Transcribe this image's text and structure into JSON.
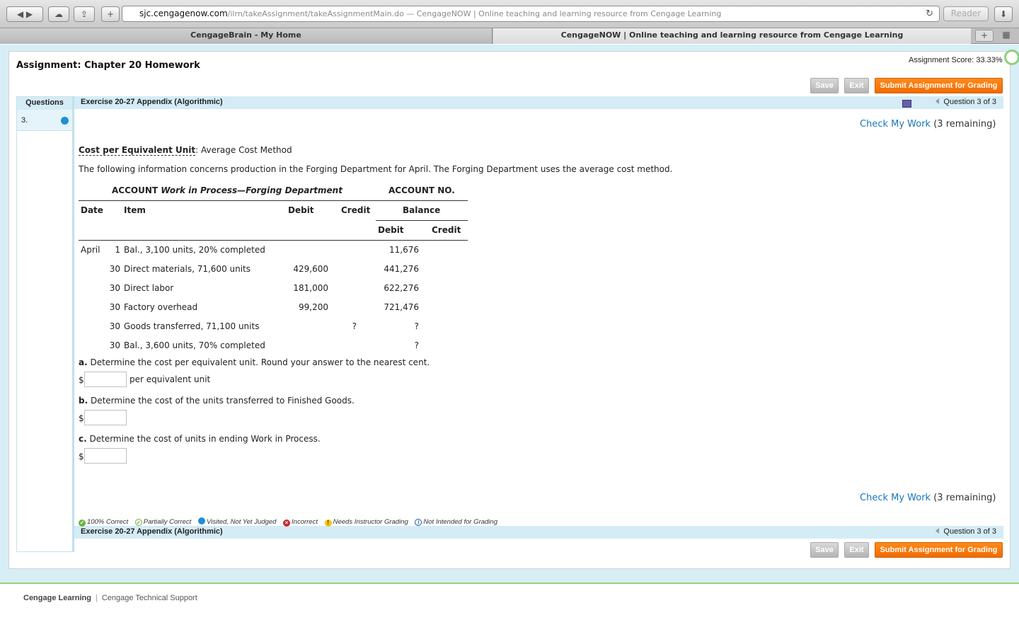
{
  "browser": {
    "url_domain": "sjc.cengagenow.com",
    "url_path": "/ilrn/takeAssignment/takeAssignmentMain.do",
    "url_title": " — CengageNOW | Online teaching and learning resource from Cengage Learning",
    "reader_label": "Reader",
    "tabs": [
      {
        "label": "CengageBrain - My Home"
      },
      {
        "label": "CengageNOW | Online teaching and learning resource from Cengage Learning"
      }
    ]
  },
  "assignment": {
    "title": "Assignment: Chapter 20 Homework",
    "score": "Assignment Score: 33.33%"
  },
  "buttons": {
    "save": "Save",
    "exit": "Exit",
    "submit": "Submit Assignment for Grading"
  },
  "sidebar": {
    "header": "Questions",
    "items": [
      {
        "label": "3.",
        "status": "visited"
      }
    ]
  },
  "exercise": {
    "title": "Exercise 20-27 Appendix (Algorithmic)",
    "question_nav": "Question 3 of 3",
    "check_link": "Check My Work",
    "check_remaining": "(3 remaining)"
  },
  "problem": {
    "topic": "Cost per Equivalent Unit",
    "topic_rest": ": Average Cost Method",
    "description": "The following information concerns production in the Forging Department for April. The Forging Department uses the average cost method.",
    "account_prefix": "ACCOUNT",
    "account_name": "Work in Process—Forging Department",
    "account_no": "ACCOUNT NO.",
    "headers": {
      "date": "Date",
      "item": "Item",
      "debit": "Debit",
      "credit": "Credit",
      "balance": "Balance",
      "bal_debit": "Debit",
      "bal_credit": "Credit"
    },
    "rows": [
      {
        "month": "April",
        "day": "1",
        "item": "Bal., 3,100 units, 20% completed",
        "debit": "",
        "credit": "",
        "bal_debit": "11,676"
      },
      {
        "month": "",
        "day": "30",
        "item": "Direct materials, 71,600 units",
        "debit": "429,600",
        "credit": "",
        "bal_debit": "441,276"
      },
      {
        "month": "",
        "day": "30",
        "item": "Direct labor",
        "debit": "181,000",
        "credit": "",
        "bal_debit": "622,276"
      },
      {
        "month": "",
        "day": "30",
        "item": "Factory overhead",
        "debit": "99,200",
        "credit": "",
        "bal_debit": "721,476"
      },
      {
        "month": "",
        "day": "30",
        "item": "Goods transferred, 71,100 units",
        "debit": "",
        "credit": "?",
        "bal_debit": "?"
      },
      {
        "month": "",
        "day": "30",
        "item": "Bal., 3,600 units, 70% completed",
        "debit": "",
        "credit": "",
        "bal_debit": "?"
      }
    ],
    "questions": [
      {
        "letter": "a.",
        "text": " Determine the cost per equivalent unit. Round your answer to the nearest cent.",
        "prefix": "$",
        "value": "",
        "suffix": "per equivalent unit"
      },
      {
        "letter": "b.",
        "text": " Determine the cost of the units transferred to Finished Goods.",
        "prefix": "$",
        "value": "",
        "suffix": ""
      },
      {
        "letter": "c.",
        "text": " Determine the cost of units in ending Work in Process.",
        "prefix": "$",
        "value": "",
        "suffix": ""
      }
    ]
  },
  "legend": [
    {
      "label": "100% Correct",
      "icon": "check-circle-icon",
      "color": "#6cb33f"
    },
    {
      "label": "Partially Correct",
      "icon": "partial-circle-icon",
      "color": "#6cb33f"
    },
    {
      "label": "Visited, Not Yet Judged",
      "icon": "blue-dot-icon",
      "color": "#1e8fd6"
    },
    {
      "label": "Incorrect",
      "icon": "x-circle-icon",
      "color": "#c8282e"
    },
    {
      "label": "Needs Instructor Grading",
      "icon": "exclamation-circle-icon",
      "color": "#f3c400"
    },
    {
      "label": "Not Intended for Grading",
      "icon": "no-circle-icon",
      "color": "#1a5a9e"
    }
  ],
  "footer": {
    "brand": "Cengage Learning",
    "support": "Cengage Technical Support"
  }
}
